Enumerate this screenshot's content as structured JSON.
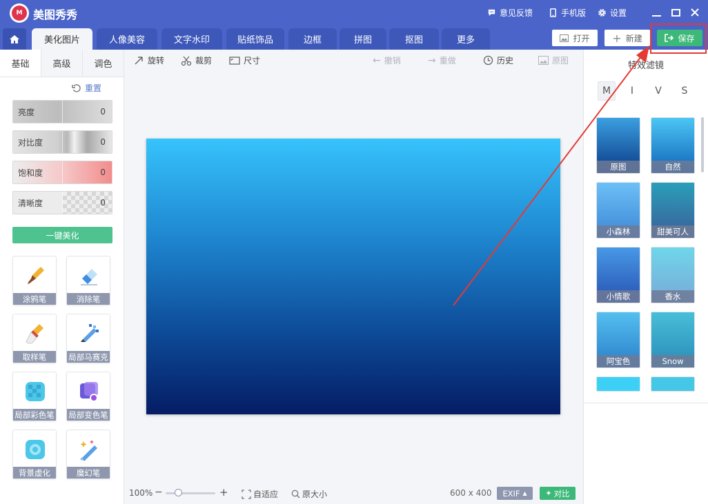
{
  "app": {
    "title": "美图秀秀"
  },
  "titlebar": {
    "feedback": "意见反馈",
    "mobile": "手机版",
    "settings": "设置"
  },
  "tabs": [
    "美化图片",
    "人像美容",
    "文字水印",
    "贴纸饰品",
    "边框",
    "拼图",
    "抠图",
    "更多"
  ],
  "header_actions": {
    "open": "打开",
    "new": "新建",
    "save": "保存"
  },
  "left": {
    "subtabs": [
      "基础",
      "高级",
      "调色"
    ],
    "reset": "重置",
    "sliders": [
      {
        "label": "亮度",
        "value": "0"
      },
      {
        "label": "对比度",
        "value": "0"
      },
      {
        "label": "饱和度",
        "value": "0"
      },
      {
        "label": "清晰度",
        "value": "0"
      }
    ],
    "one_key": "一键美化",
    "tools": [
      "涂鸦笔",
      "消除笔",
      "取样笔",
      "局部马赛克",
      "局部彩色笔",
      "局部变色笔",
      "背景虚化",
      "魔幻笔"
    ]
  },
  "toolbar": {
    "rotate": "旋转",
    "crop": "裁剪",
    "size": "尺寸",
    "undo": "撤销",
    "redo": "重做",
    "history": "历史",
    "original": "原图"
  },
  "bottom": {
    "zoom": "100%",
    "fit": "自适应",
    "actual": "原大小",
    "dims": "600 x 400",
    "exif": "EXIF",
    "compare": "对比"
  },
  "right": {
    "title": "特效滤镜",
    "categories": [
      "M",
      "I",
      "V",
      "S"
    ],
    "filters": [
      {
        "name": "原图",
        "top": "#3b9fe0",
        "bottom": "#0a3a86"
      },
      {
        "name": "自然",
        "top": "#4cc6f4",
        "bottom": "#1064b8"
      },
      {
        "name": "小森林",
        "top": "#6cc0f6",
        "bottom": "#3d86d6"
      },
      {
        "name": "甜美可人",
        "top": "#2a9fb8",
        "bottom": "#3a5e9a"
      },
      {
        "name": "小情歌",
        "top": "#4898e6",
        "bottom": "#2752b2"
      },
      {
        "name": "香水",
        "top": "#6fd6ea",
        "bottom": "#79a9d6"
      },
      {
        "name": "阿宝色",
        "top": "#54bff0",
        "bottom": "#2a7ec8"
      },
      {
        "name": "Snow",
        "top": "#48bfd8",
        "bottom": "#2a8ab8"
      },
      {
        "name": "",
        "top": "#3cd0f6",
        "bottom": "#3cd0f6"
      },
      {
        "name": "",
        "top": "#45c7e6",
        "bottom": "#45c7e6"
      }
    ]
  }
}
